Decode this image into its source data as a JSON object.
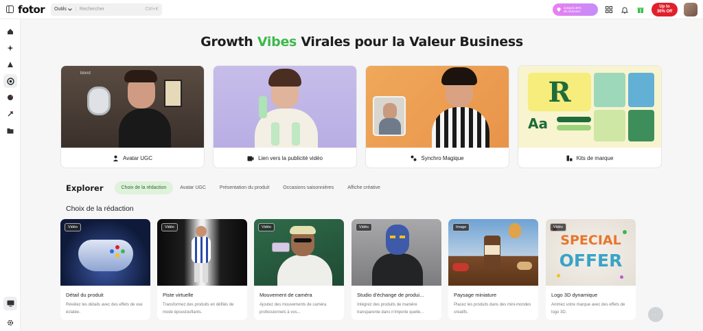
{
  "app": {
    "logo": "fotor"
  },
  "search": {
    "tools_label": "Outils",
    "placeholder": "Rechercher",
    "shortcut": "Ctrl+K"
  },
  "header": {
    "promo_line1": "Jusqu'à 30%",
    "promo_line2": "de réduction",
    "offer_line1": "Up to",
    "offer_line2": "30% Off"
  },
  "hero": {
    "title_part1": "Growth ",
    "title_accent": "Vibes",
    "title_part2": " Virales pour la Valeur Business"
  },
  "features": [
    {
      "label": "Avatar UGC",
      "icon": "avatar-icon"
    },
    {
      "label": "Lien vers la publicité vidéo",
      "icon": "video-link-icon"
    },
    {
      "label": "Synchro Magique",
      "icon": "sync-icon"
    },
    {
      "label": "Kits de marque",
      "icon": "brand-kit-icon"
    }
  ],
  "explore": {
    "title": "Explorer",
    "tabs": [
      "Choix de la rédaction",
      "Avatar UGC",
      "Présentation du produit",
      "Occasions saisonnières",
      "Affiche créative"
    ]
  },
  "section": {
    "title": "Choix de la rédaction"
  },
  "cards": [
    {
      "badge": "Vidéo",
      "title": "Détail du produit",
      "desc": "Révélez les détails avec des effets de vue éclatée."
    },
    {
      "badge": "Vidéo",
      "title": "Piste virtuelle",
      "desc": "Transformez des produits en défilés de mode époustouflants."
    },
    {
      "badge": "Vidéo",
      "title": "Mouvement de caméra",
      "desc": "Ajoutez des mouvements de caméra professionnels à vos..."
    },
    {
      "badge": "Vidéo",
      "title": "Studio d'échange de produi...",
      "desc": "Intégrez des produits de manière transparente dans n'importe quelle..."
    },
    {
      "badge": "Image",
      "title": "Paysage miniature",
      "desc": "Placez les produits dans des mini-mondes créatifs."
    },
    {
      "badge": "Vidéo",
      "title": "Logo 3D dynamique",
      "desc": "Animez votre marque avec des effets de logo 3D."
    }
  ],
  "thumb_texts": {
    "brand_letter": "R",
    "brand_aa": "Aa",
    "offer_word1": "SPECIAL",
    "offer_word2": "OFFER",
    "hat_text": "blond"
  },
  "colors": {
    "accent_green": "#3db84a",
    "offer_red": "#e0202c",
    "promo_pink": "#e97ff1"
  },
  "more_button": "···"
}
